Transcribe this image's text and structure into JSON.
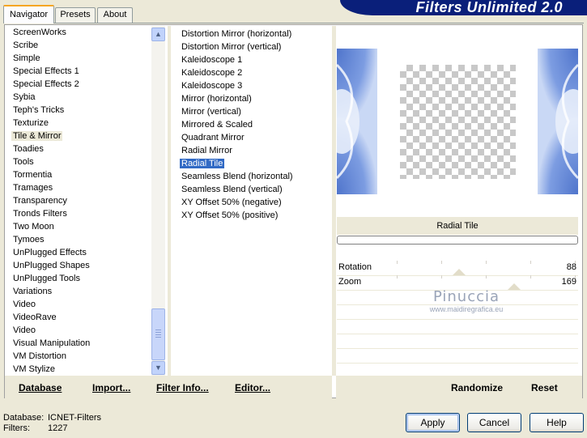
{
  "tabs": [
    "Navigator",
    "Presets",
    "About"
  ],
  "banner_title": "Filters Unlimited 2.0",
  "categories": [
    "ScreenWorks",
    "Scribe",
    "Simple",
    "Special Effects 1",
    "Special Effects 2",
    "Sybia",
    "Teph's Tricks",
    "Texturize",
    "Tile & Mirror",
    "Toadies",
    "Tools",
    "Tormentia",
    "Tramages",
    "Transparency",
    "Tronds Filters",
    "Two Moon",
    "Tymoes",
    "UnPlugged Effects",
    "UnPlugged Shapes",
    "UnPlugged Tools",
    "Variations",
    "Video",
    "VideoRave",
    "Video",
    "Visual Manipulation",
    "VM Distortion",
    "VM Stylize"
  ],
  "selected_category": "Tile & Mirror",
  "filters": [
    "Distortion Mirror (horizontal)",
    "Distortion Mirror (vertical)",
    "Kaleidoscope 1",
    "Kaleidoscope 2",
    "Kaleidoscope 3",
    "Mirror (horizontal)",
    "Mirror (vertical)",
    "Mirrored & Scaled",
    "Quadrant Mirror",
    "Radial Mirror",
    "Radial Tile",
    "Seamless Blend (horizontal)",
    "Seamless Blend (vertical)",
    "XY Offset 50% (negative)",
    "XY Offset 50% (positive)"
  ],
  "selected_filter": "Radial Tile",
  "preview_title": "Radial Tile",
  "parameters": [
    {
      "label": "Rotation",
      "value": "88",
      "level": 0.35
    },
    {
      "label": "Zoom",
      "value": "169",
      "level": 0.66
    }
  ],
  "watermark": {
    "line1": "Pinuccia",
    "line2": "www.maidiregrafica.eu"
  },
  "left_buttons": [
    "Database",
    "Import...",
    "Filter Info...",
    "Editor..."
  ],
  "right_buttons": [
    "Randomize",
    "Reset"
  ],
  "status": {
    "database_label": "Database:",
    "database_value": "ICNET-Filters",
    "filters_label": "Filters:",
    "filters_value": "1227"
  },
  "dialog_buttons": [
    "Apply",
    "Cancel",
    "Help"
  ],
  "colors": {
    "selection": "#316ac5",
    "banner": "#0a1f7a",
    "preview_blue": "#4a74c9"
  },
  "icons": {
    "scroll_up": "scroll-up-arrow-icon",
    "scroll_down": "scroll-down-arrow-icon"
  }
}
